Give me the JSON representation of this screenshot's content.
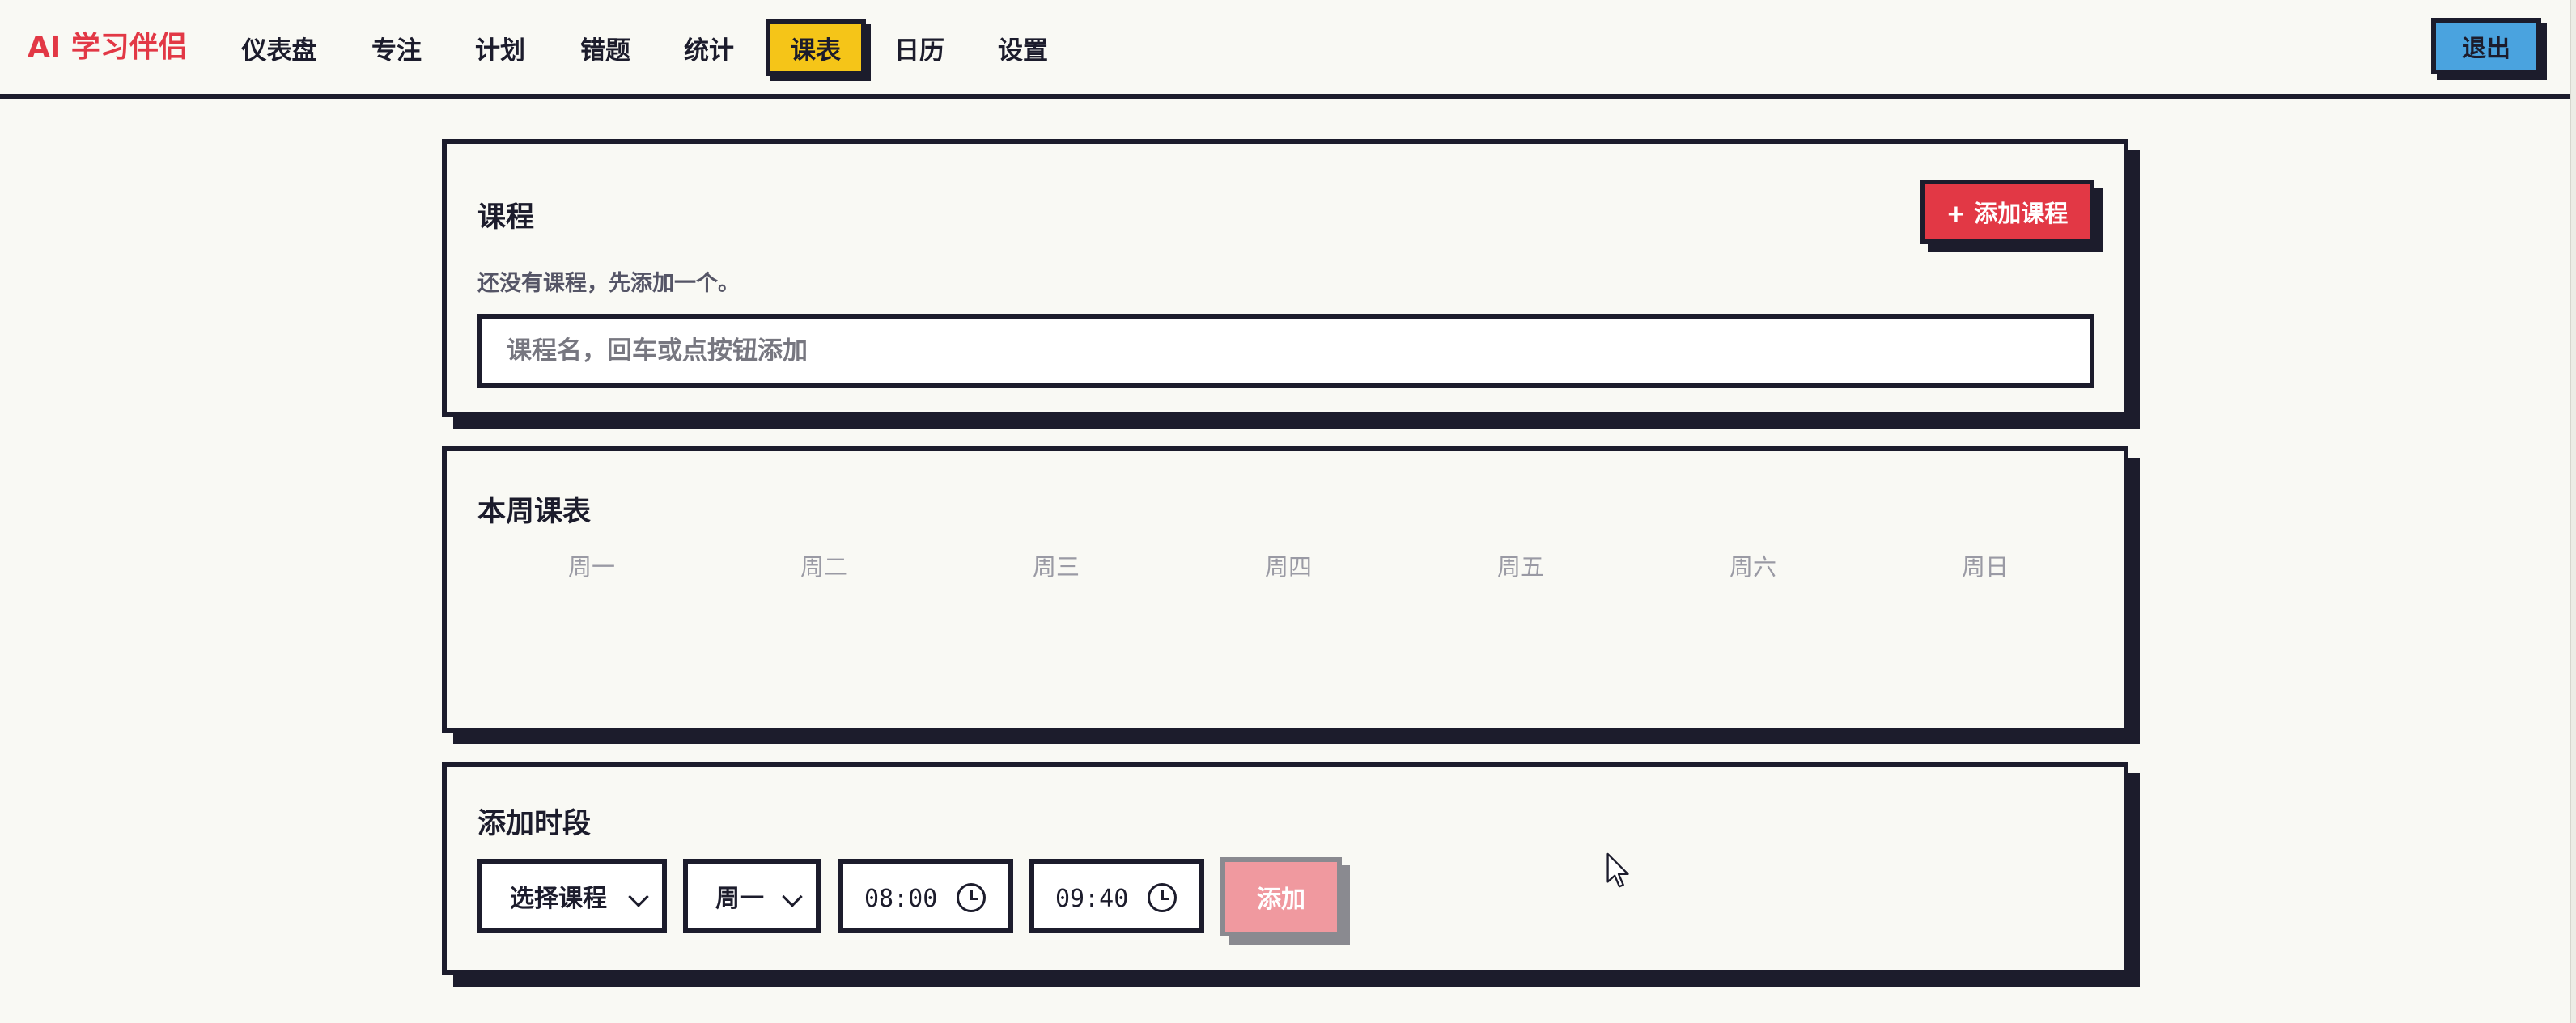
{
  "app": {
    "logo": "AI 学习伴侣"
  },
  "nav": {
    "items": [
      {
        "label": "仪表盘",
        "active": false
      },
      {
        "label": "专注",
        "active": false
      },
      {
        "label": "计划",
        "active": false
      },
      {
        "label": "错题",
        "active": false
      },
      {
        "label": "统计",
        "active": false
      },
      {
        "label": "课表",
        "active": true
      },
      {
        "label": "日历",
        "active": false
      },
      {
        "label": "设置",
        "active": false
      }
    ],
    "logout_label": "退出"
  },
  "courses": {
    "title": "课程",
    "add_button": "+ 添加课程",
    "empty_hint": "还没有课程，先添加一个。",
    "input_placeholder": "课程名，回车或点按钮添加",
    "input_value": ""
  },
  "week": {
    "title": "本周课表",
    "days": [
      "周一",
      "周二",
      "周三",
      "周四",
      "周五",
      "周六",
      "周日"
    ]
  },
  "slot": {
    "title": "添加时段",
    "course_select": "选择课程",
    "day_select": "周一",
    "start_time": "08:00",
    "end_time": "09:40",
    "add_button": "添加"
  },
  "colors": {
    "background": "#f9f9f4",
    "ink": "#1c1c2c",
    "accent_red": "#e23845",
    "accent_yellow": "#f5c518",
    "accent_blue": "#4aa3df",
    "disabled_pink": "#f0999f"
  },
  "icons": {
    "select_chevron": "chevron-down-icon",
    "time": "clock-icon",
    "pointer": "mouse-cursor-icon"
  }
}
